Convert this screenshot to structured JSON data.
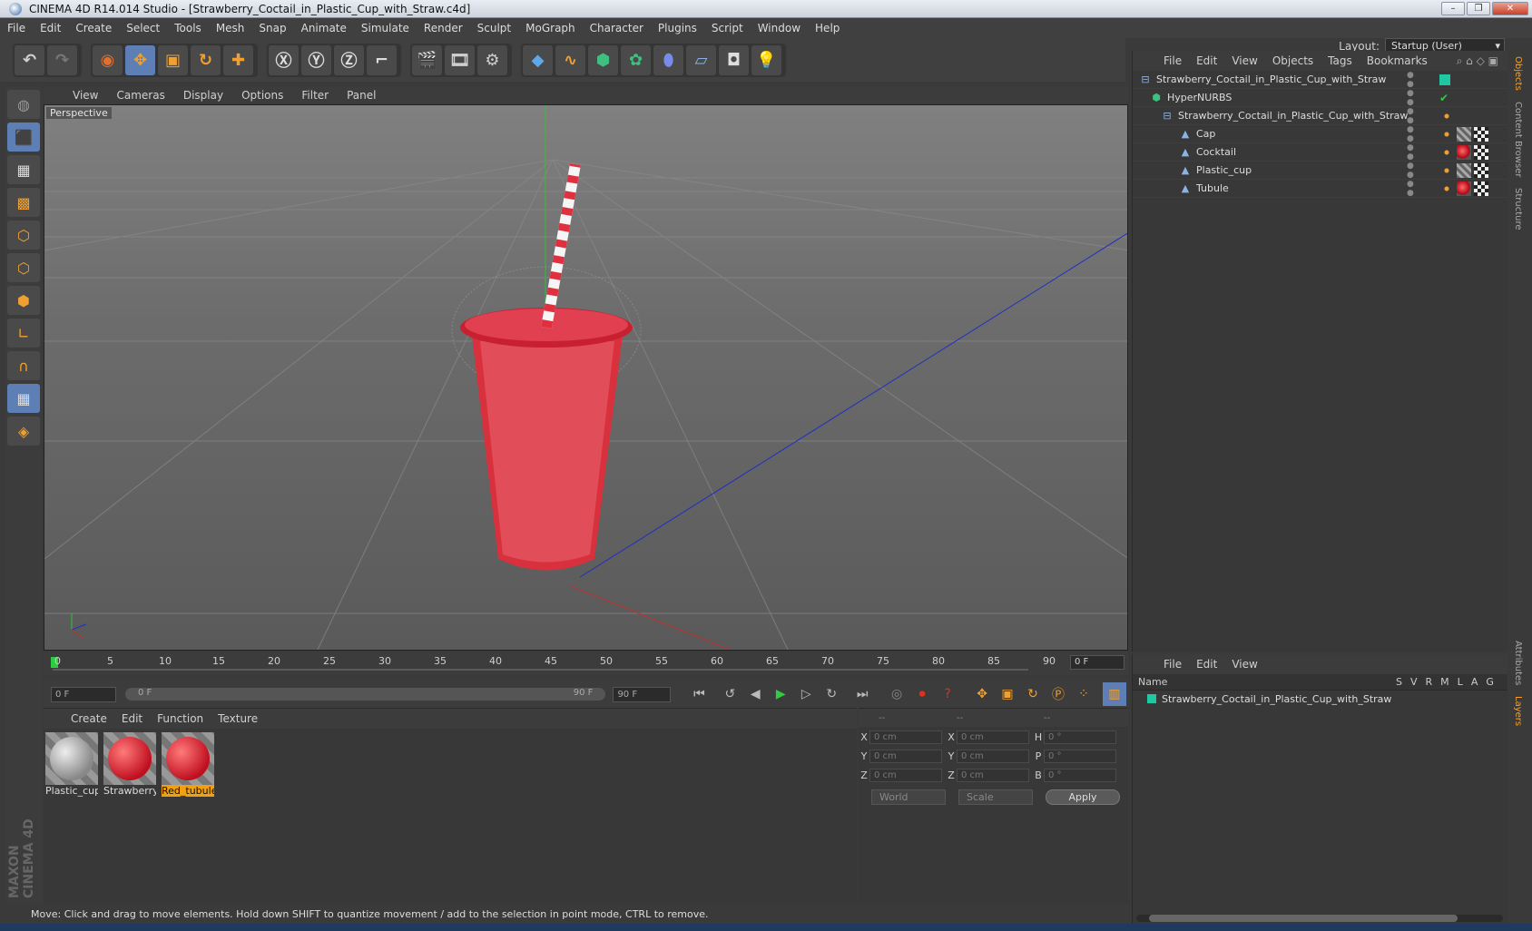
{
  "window": {
    "title": "CINEMA 4D R14.014 Studio - [Strawberry_Coctail_in_Plastic_Cup_with_Straw.c4d]"
  },
  "menu": [
    "File",
    "Edit",
    "Create",
    "Select",
    "Tools",
    "Mesh",
    "Snap",
    "Animate",
    "Simulate",
    "Render",
    "Sculpt",
    "MoGraph",
    "Character",
    "Plugins",
    "Script",
    "Window",
    "Help"
  ],
  "layout": {
    "label": "Layout:",
    "value": "Startup (User)"
  },
  "viewport": {
    "menu": [
      "View",
      "Cameras",
      "Display",
      "Options",
      "Filter",
      "Panel"
    ],
    "label": "Perspective"
  },
  "timeline": {
    "ticks": [
      "0",
      "5",
      "10",
      "15",
      "20",
      "25",
      "30",
      "35",
      "40",
      "45",
      "50",
      "55",
      "60",
      "65",
      "70",
      "75",
      "80",
      "85",
      "90"
    ],
    "frame_field": "0 F"
  },
  "playbar": {
    "start": "0 F",
    "range_start": "0 F",
    "range_end": "90 F",
    "end": "90 F"
  },
  "materials": {
    "menu": [
      "Create",
      "Edit",
      "Function",
      "Texture"
    ],
    "items": [
      {
        "name": "Plastic_cup",
        "kind": "plastic"
      },
      {
        "name": "Strawberry",
        "kind": "red"
      },
      {
        "name": "Red_tubule",
        "kind": "red",
        "selected": true
      }
    ]
  },
  "coords": {
    "headers": [
      "--",
      "--",
      "--"
    ],
    "rows": [
      {
        "a1": "X",
        "v1": "0 cm",
        "a2": "X",
        "v2": "0 cm",
        "a3": "H",
        "v3": "0 °"
      },
      {
        "a1": "Y",
        "v1": "0 cm",
        "a2": "Y",
        "v2": "0 cm",
        "a3": "P",
        "v3": "0 °"
      },
      {
        "a1": "Z",
        "v1": "0 cm",
        "a2": "Z",
        "v2": "0 cm",
        "a3": "B",
        "v3": "0 °"
      }
    ],
    "world": "World",
    "scale": "Scale",
    "apply": "Apply"
  },
  "objects": {
    "menu": [
      "File",
      "Edit",
      "View",
      "Objects",
      "Tags",
      "Bookmarks"
    ],
    "items": [
      {
        "name": "Strawberry_Coctail_in_Plastic_Cup_with_Straw",
        "indent": 0,
        "icon": "null-icon"
      },
      {
        "name": "HyperNURBS",
        "indent": 1,
        "icon": "hypernurbs-icon"
      },
      {
        "name": "Strawberry_Coctail_in_Plastic_Cup_with_Straw",
        "indent": 2,
        "icon": "null-icon"
      },
      {
        "name": "Cap",
        "indent": 3,
        "icon": "polygon-icon"
      },
      {
        "name": "Cocktail",
        "indent": 3,
        "icon": "polygon-icon"
      },
      {
        "name": "Plastic_cup",
        "indent": 3,
        "icon": "polygon-icon"
      },
      {
        "name": "Tubule",
        "indent": 3,
        "icon": "polygon-icon"
      }
    ]
  },
  "layers": {
    "menu": [
      "File",
      "Edit",
      "View"
    ],
    "header_name": "Name",
    "columns": [
      "S",
      "V",
      "R",
      "M",
      "L",
      "A",
      "G"
    ],
    "items": [
      "Strawberry_Coctail_in_Plastic_Cup_with_Straw"
    ]
  },
  "side_tabs": [
    "Objects",
    "Content Browser",
    "Structure",
    "Attributes",
    "Layers"
  ],
  "status": "Move: Click and drag to move elements. Hold down SHIFT to quantize movement / add to the selection in point mode, CTRL to remove.",
  "brand": "MAXON CINEMA 4D",
  "colors": {
    "accent": "#f0a030",
    "active_tool": "#5d7fb6",
    "drink": "#d8303c"
  }
}
